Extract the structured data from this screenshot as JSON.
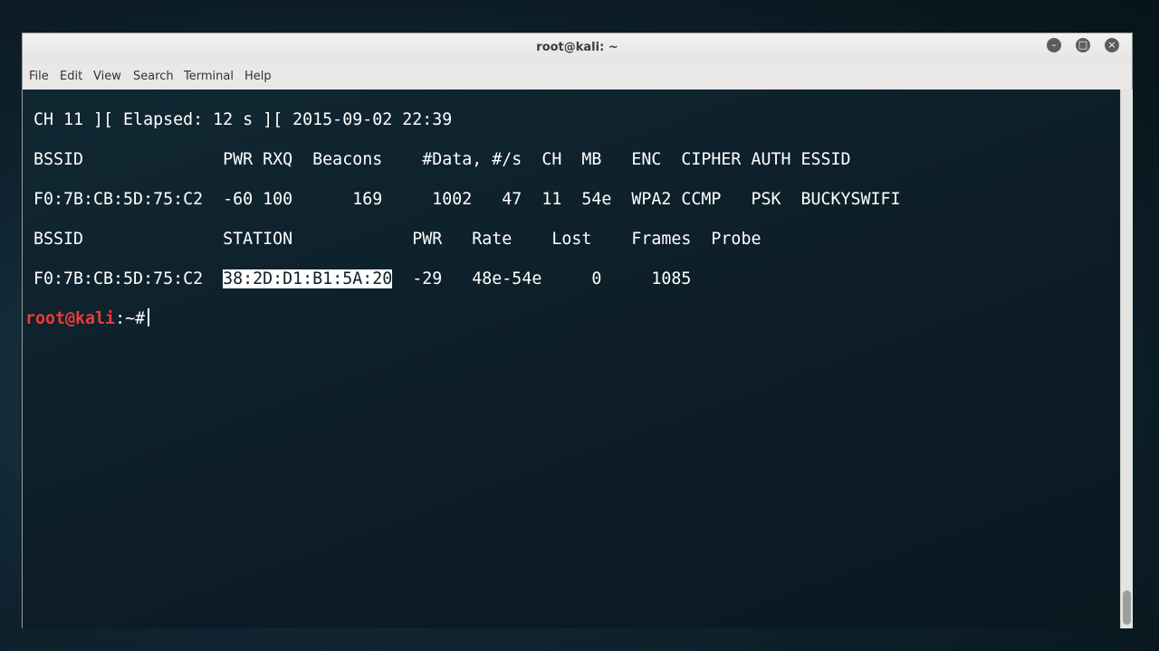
{
  "window": {
    "title": "root@kali: ~"
  },
  "window_controls": {
    "minimize": "–",
    "maximize": "□",
    "close": "×"
  },
  "menu": {
    "items": [
      "File",
      "Edit",
      "View",
      "Search",
      "Terminal",
      "Help"
    ]
  },
  "terminal": {
    "status_line": "CH 11 ][ Elapsed: 12 s ][ 2015-09-02 22:39",
    "ap_header": "BSSID              PWR RXQ  Beacons    #Data, #/s  CH  MB   ENC  CIPHER AUTH ESSID",
    "ap_row": "F0:7B:CB:5D:75:C2  -60 100      169     1002   47  11  54e  WPA2 CCMP   PSK  BUCKYSWIFI",
    "station_header": "BSSID              STATION            PWR   Rate    Lost    Frames  Probe",
    "station_row": {
      "bssid": "F0:7B:CB:5D:75:C2  ",
      "station": "38:2D:D1:B1:5A:20",
      "rest": "  -29   48e-54e     0     1085"
    },
    "prompt": {
      "user_host": "root@kali",
      "path": ":~#"
    }
  }
}
